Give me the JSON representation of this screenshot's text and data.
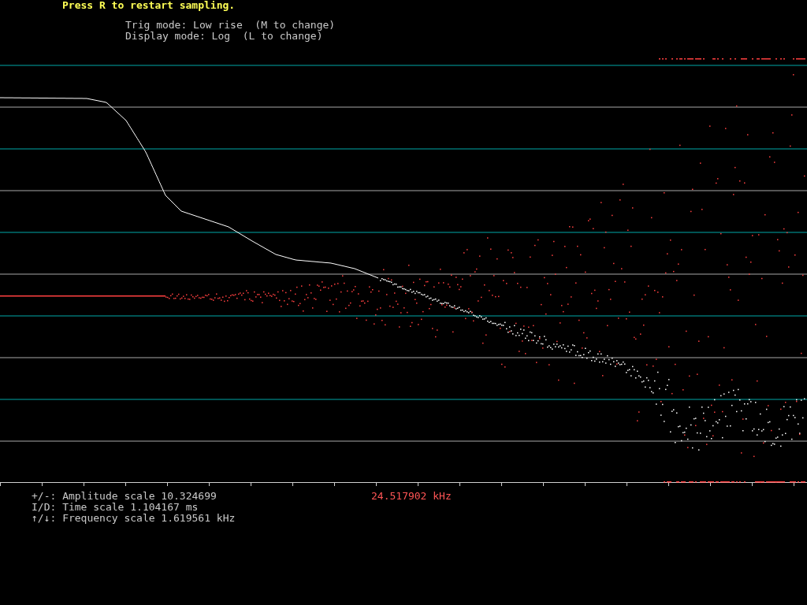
{
  "header": {
    "prompt": "Press R to restart sampling.",
    "modes": [
      "Trig mode: Low rise  (M to change)",
      "Display mode: Log  (L to change)"
    ]
  },
  "footer": {
    "scales": [
      "+/-: Amplitude scale 10.324699",
      "I/D: Time scale 1.104167 ms",
      "↑/↓: Frequency scale 1.619561 kHz"
    ],
    "frequency_readout": "24.517902 kHz"
  }
}
